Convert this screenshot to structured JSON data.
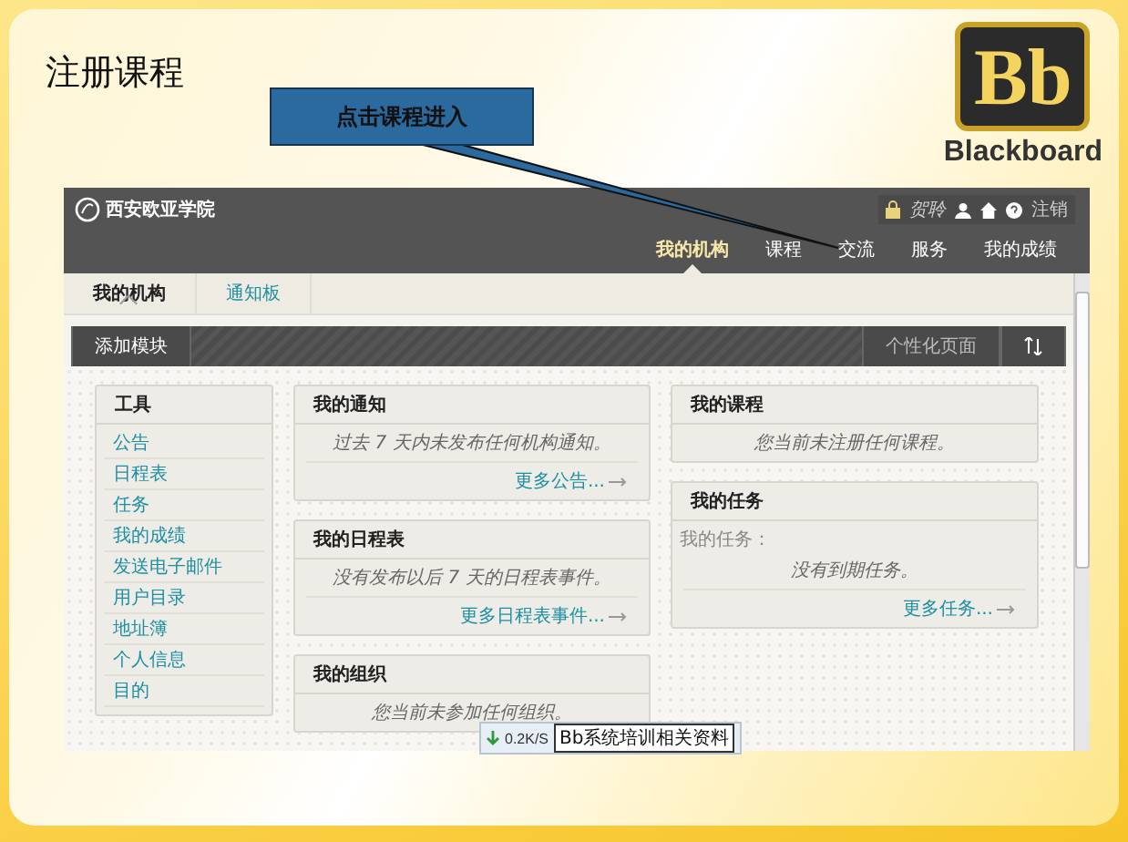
{
  "slide": {
    "title": "注册课程",
    "callout": "点击课程进入",
    "logo_mark": "Bb",
    "logo_text": "Blackboard"
  },
  "portal": {
    "institution": "西安欧亚学院",
    "user": "贺聆",
    "logout": "注销",
    "nav": [
      {
        "label": "我的机构",
        "selected": true
      },
      {
        "label": "课程",
        "selected": false
      },
      {
        "label": "交流",
        "selected": false
      },
      {
        "label": "服务",
        "selected": false
      },
      {
        "label": "我的成绩",
        "selected": false
      }
    ],
    "subtabs": [
      {
        "label": "我的机构",
        "selected": true
      },
      {
        "label": "通知板",
        "selected": false
      }
    ],
    "toolbar": {
      "add_module": "添加模块",
      "personalize": "个性化页面"
    },
    "tools": {
      "title": "工具",
      "items": [
        "公告",
        "日程表",
        "任务",
        "我的成绩",
        "发送电子邮件",
        "用户目录",
        "地址簿",
        "个人信息",
        "目的"
      ]
    },
    "columns": [
      [
        {
          "title": "我的通知",
          "message": "过去 7 天内未发布任何机构通知。",
          "link": "更多公告..."
        },
        {
          "title": "我的日程表",
          "message": "没有发布以后 7 天的日程表事件。",
          "link": "更多日程表事件..."
        },
        {
          "title": "我的组织",
          "message": "您当前未参加任何组织。"
        }
      ],
      [
        {
          "title": "我的课程",
          "message": "您当前未注册任何课程。"
        },
        {
          "title": "我的任务",
          "intro": "我的任务：",
          "message": "没有到期任务。",
          "link": "更多任务..."
        }
      ]
    ]
  },
  "status": {
    "speed": "0.2K/S",
    "tooltip": "Bb系统培训相关资料"
  }
}
